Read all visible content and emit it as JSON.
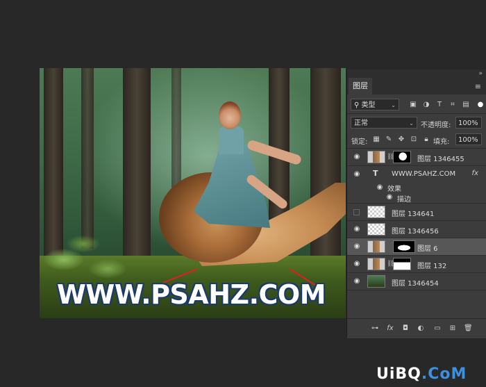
{
  "canvas": {
    "watermark_text": "WWW.PSAHZ.COM"
  },
  "panel": {
    "tab_label": "图层",
    "collapse_glyph": "»",
    "menu_glyph": "≡",
    "filter": {
      "label": "类型",
      "icon": "search-icon"
    },
    "blend_mode": "正常",
    "opacity_label": "不透明度:",
    "opacity_value": "100%",
    "lock_label": "锁定:",
    "fill_label": "填充:",
    "fill_value": "100%",
    "layers": [
      {
        "name": "图层 1346455",
        "visible": true,
        "selected": false,
        "thumb": "photo",
        "mask": "mask3",
        "linked": true
      },
      {
        "name": "WWW.PSAHZ.COM",
        "visible": true,
        "selected": false,
        "type": "text",
        "fx": "fx"
      },
      {
        "name": "效果",
        "visible": true,
        "sub": true
      },
      {
        "name": "描边",
        "visible": true,
        "sub": true
      },
      {
        "name": "图层 134641",
        "visible": false,
        "selected": false,
        "thumb": "checker"
      },
      {
        "name": "图层 1346456",
        "visible": true,
        "selected": false,
        "thumb": "checker"
      },
      {
        "name": "图层 6",
        "visible": true,
        "selected": true,
        "thumb": "photo",
        "mask": "mask"
      },
      {
        "name": "图层 132",
        "visible": true,
        "selected": false,
        "thumb": "photo",
        "mask": "mask2",
        "linked": true
      },
      {
        "name": "图层 1346454",
        "visible": true,
        "selected": false,
        "thumb": "forest"
      }
    ],
    "footer_icons": [
      "link-icon",
      "fx-icon",
      "mask-icon",
      "adjustment-icon",
      "folder-icon",
      "new-layer-icon",
      "trash-icon"
    ],
    "footer_fx": "fx"
  },
  "brand": {
    "part1": "UiBQ",
    "part2": ".CoM"
  }
}
